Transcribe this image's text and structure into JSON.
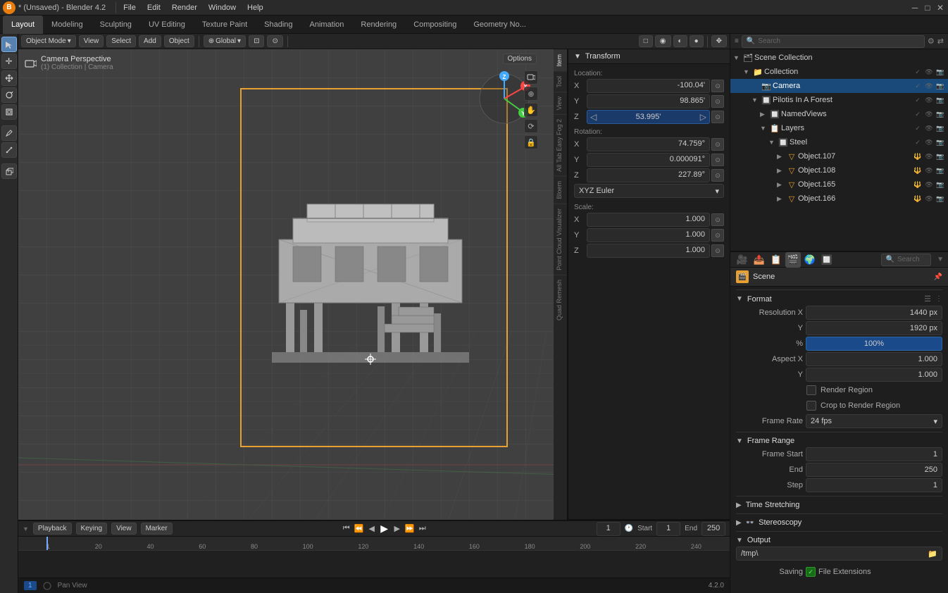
{
  "titlebar": {
    "title": "* (Unsaved) - Blender 4.2",
    "icon": "B"
  },
  "topmenu": {
    "items": [
      "File",
      "Edit",
      "Render",
      "Window",
      "Help"
    ]
  },
  "workspace_tabs": [
    {
      "label": "Layout",
      "active": true
    },
    {
      "label": "Modeling",
      "active": false
    },
    {
      "label": "Sculpting",
      "active": false
    },
    {
      "label": "UV Editing",
      "active": false
    },
    {
      "label": "Texture Paint",
      "active": false
    },
    {
      "label": "Shading",
      "active": false
    },
    {
      "label": "Animation",
      "active": false
    },
    {
      "label": "Rendering",
      "active": false
    },
    {
      "label": "Compositing",
      "active": false
    },
    {
      "label": "Geometry No...",
      "active": false
    }
  ],
  "viewport": {
    "mode": "Object Mode",
    "camera_label": "Camera Perspective",
    "collection_label": "(1) Collection | Camera",
    "options_btn": "Options",
    "global_label": "Global"
  },
  "transform": {
    "header": "Transform",
    "location_label": "Location:",
    "rotation_label": "Rotation:",
    "scale_label": "Scale:",
    "location": {
      "x": "-100.04'",
      "y": "98.865'",
      "z": "53.995'"
    },
    "rotation": {
      "x": "74.759°",
      "y": "0.000091°",
      "z": "227.89°"
    },
    "scale": {
      "x": "1.000",
      "y": "1.000",
      "z": "1.000"
    },
    "rotation_mode": "XYZ Euler"
  },
  "outliner": {
    "search_placeholder": "Search",
    "scene_collection": "Scene Collection",
    "items": [
      {
        "name": "Collection",
        "indent": 0,
        "expanded": true,
        "icon": "folder",
        "type": "collection"
      },
      {
        "name": "Camera",
        "indent": 1,
        "expanded": false,
        "icon": "camera",
        "type": "camera",
        "selected": true
      },
      {
        "name": "Pilotis In A Forest",
        "indent": 1,
        "expanded": true,
        "icon": "mesh",
        "type": "object"
      },
      {
        "name": "NamedViews",
        "indent": 2,
        "expanded": false,
        "icon": "view",
        "type": "view"
      },
      {
        "name": "Layers",
        "indent": 2,
        "expanded": true,
        "icon": "layer",
        "type": "layer"
      },
      {
        "name": "Steel",
        "indent": 3,
        "expanded": true,
        "icon": "mesh",
        "type": "mesh"
      },
      {
        "name": "Object.107",
        "indent": 4,
        "expanded": false,
        "icon": "mesh",
        "type": "mesh"
      },
      {
        "name": "Object.108",
        "indent": 4,
        "expanded": false,
        "icon": "mesh",
        "type": "mesh"
      },
      {
        "name": "Object.165",
        "indent": 4,
        "expanded": false,
        "icon": "mesh",
        "type": "mesh"
      },
      {
        "name": "Object.166",
        "indent": 4,
        "expanded": false,
        "icon": "mesh",
        "type": "mesh"
      }
    ]
  },
  "scene_props": {
    "search_placeholder": "Search",
    "scene_label": "Scene",
    "format_section": "Format",
    "resolution_x": "1440 px",
    "resolution_y": "1920 px",
    "percent": "100%",
    "aspect_x": "1.000",
    "aspect_y": "1.000",
    "render_region_label": "Render Region",
    "crop_render_region_label": "Crop to Render Region",
    "frame_rate_label": "Frame Rate",
    "frame_rate_value": "24 fps",
    "frame_range_section": "Frame Range",
    "frame_start_label": "Frame Start",
    "frame_start_value": "1",
    "end_label": "End",
    "end_value": "250",
    "step_label": "Step",
    "step_value": "1",
    "time_stretching": "Time Stretching",
    "stereoscopy": "Stereoscopy",
    "output_section": "Output",
    "output_path": "/tmp\\",
    "saving_label": "Saving",
    "file_extensions_label": "File Extensions"
  },
  "timeline": {
    "playback_label": "Playback",
    "keying_label": "Keying",
    "view_label": "View",
    "marker_label": "Marker",
    "current_frame": "1",
    "start_label": "Start",
    "start_value": "1",
    "end_label": "End",
    "end_value": "250",
    "ruler_marks": [
      "20",
      "40",
      "60",
      "80",
      "100",
      "120",
      "140",
      "160",
      "180",
      "200",
      "220",
      "240"
    ]
  },
  "status": {
    "pan_view": "Pan View",
    "version": "4.2.0",
    "frame_indicator": "1"
  },
  "right_tabs": [
    "Item",
    "Tool",
    "View"
  ],
  "side_tabs": [
    "All Tab Easy Fog 2",
    "Bloem",
    "Point Cloud Visualizer",
    "Quad Remesh"
  ]
}
